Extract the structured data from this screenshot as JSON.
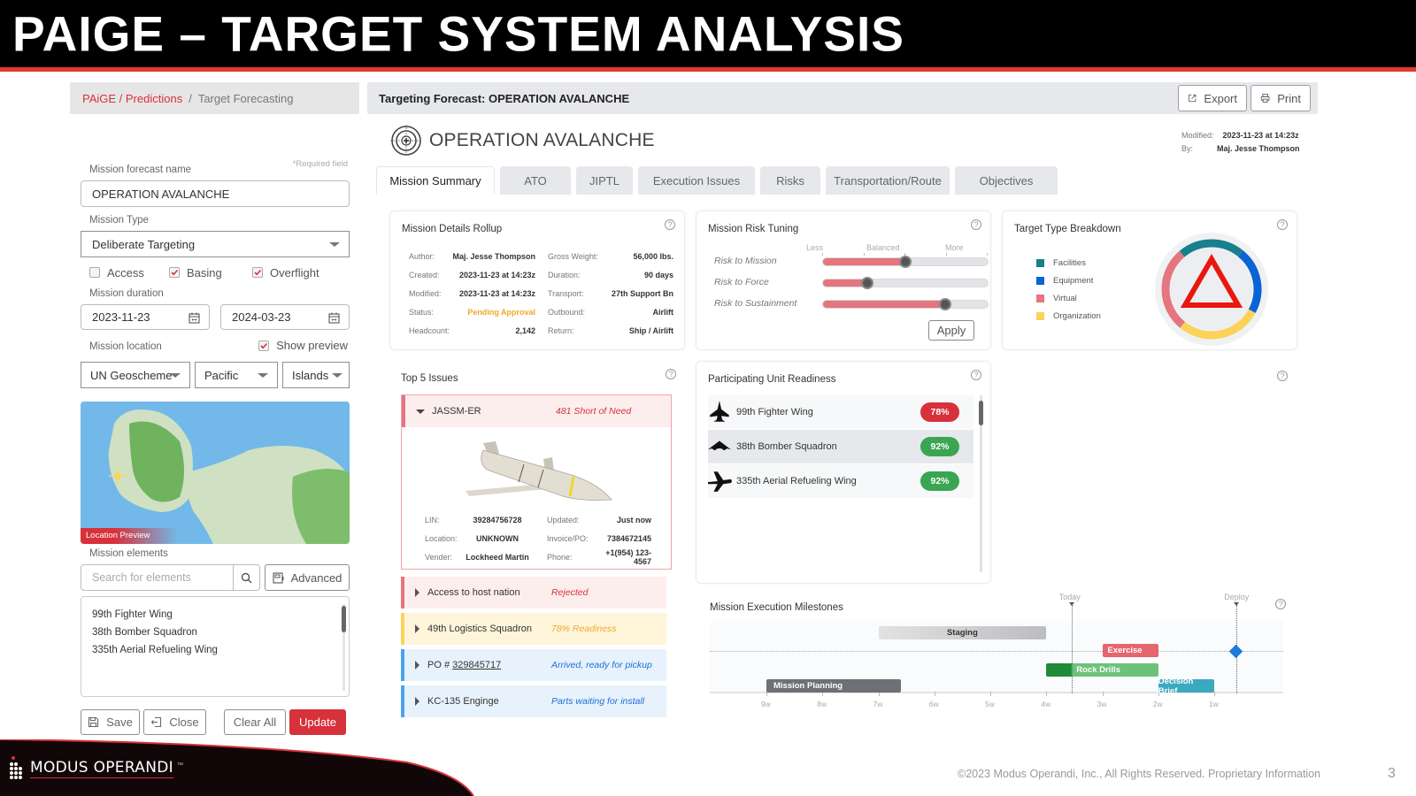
{
  "slide": {
    "title": "PAIGE – TARGET SYSTEM ANALYSIS",
    "footer": "©2023  Modus Operandi, Inc., All Rights Reserved.  Proprietary Information",
    "page_number": "3",
    "logo_text": "MODUS OPERANDI",
    "logo_tm": "™"
  },
  "breadcrumb": {
    "link": "PAiGE / Predictions",
    "separator": "/",
    "current": "Target Forecasting"
  },
  "header": {
    "title": "Targeting Forecast: OPERATION AVALANCHE",
    "export_label": "Export",
    "print_label": "Print"
  },
  "form": {
    "required_note": "*Required field",
    "name_label": "Mission forecast name",
    "name_value": "OPERATION AVALANCHE",
    "type_label": "Mission Type",
    "type_value": "Deliberate Targeting",
    "checkboxes": [
      {
        "label": "Access",
        "checked": false
      },
      {
        "label": "Basing",
        "checked": true
      },
      {
        "label": "Overflight",
        "checked": true
      }
    ],
    "duration_label": "Mission duration",
    "start_date": "2023-11-23",
    "end_date": "2024-03-23",
    "location_label": "Mission location",
    "show_preview_label": "Show preview",
    "show_preview_checked": true,
    "location_selects": [
      "UN Geoscheme",
      "Pacific",
      "Islands"
    ],
    "map_label": "Location Preview",
    "elements_label": "Mission elements",
    "search_placeholder": "Search for elements",
    "advanced_label": "Advanced",
    "elements": [
      "99th Fighter Wing",
      "38th Bomber Squadron",
      "335th Aerial Refueling Wing"
    ],
    "buttons": {
      "save": "Save",
      "close": "Close",
      "clear_all": "Clear All",
      "update": "Update"
    }
  },
  "operation": {
    "title": "OPERATION AVALANCHE",
    "modified_label": "Modified:",
    "modified_value": "2023-11-23 at 14:23z",
    "by_label": "By:",
    "by_value": "Maj. Jesse Thompson"
  },
  "tabs": [
    {
      "label": "Mission Summary",
      "active": true
    },
    {
      "label": "ATO",
      "active": false
    },
    {
      "label": "JIPTL",
      "active": false
    },
    {
      "label": "Execution Issues",
      "active": false
    },
    {
      "label": "Risks",
      "active": false
    },
    {
      "label": "Transportation/Route",
      "active": false
    },
    {
      "label": "Objectives",
      "active": false
    }
  ],
  "rollup": {
    "title": "Mission Details Rollup",
    "rows": [
      {
        "k1": "Author:",
        "v1": "Maj. Jesse Thompson",
        "k2": "Gross Weight:",
        "v2": "56,000 lbs."
      },
      {
        "k1": "Created:",
        "v1": "2023-11-23 at 14:23z",
        "k2": "Duration:",
        "v2": "90 days"
      },
      {
        "k1": "Modified:",
        "v1": "2023-11-23 at 14:23z",
        "k2": "Transport:",
        "v2": "27th Support Bn"
      },
      {
        "k1": "Status:",
        "v1": "Pending Approval",
        "k2": "Outbound:",
        "v2": "Airlift"
      },
      {
        "k1": "Headcount:",
        "v1": "2,142",
        "k2": "Return:",
        "v2": "Ship / Airlift"
      }
    ]
  },
  "risk": {
    "title": "Mission Risk Tuning",
    "scale": [
      "Less",
      "Balanced",
      "More"
    ],
    "sliders": [
      {
        "label": "Risk to Mission",
        "value": 0.5
      },
      {
        "label": "Risk to Force",
        "value": 0.27
      },
      {
        "label": "Risk to Sustainment",
        "value": 0.74
      }
    ],
    "apply_label": "Apply"
  },
  "breakdown": {
    "title": "Target Type Breakdown",
    "legend": [
      {
        "label": "Facilities",
        "color": "#17808c",
        "share": 0.22
      },
      {
        "label": "Equipment",
        "color": "#0a64d6",
        "share": 0.22
      },
      {
        "label": "Virtual",
        "color": "#e5757e",
        "share": 0.28
      },
      {
        "label": "Organization",
        "color": "#fcd25a",
        "share": 0.28
      }
    ]
  },
  "issues": {
    "title": "Top 5 Issues",
    "expanded": {
      "name": "JASSM-ER",
      "status": "481 Short of Need",
      "details": [
        {
          "k1": "LIN:",
          "v1": "39284756728",
          "k2": "Updated:",
          "v2": "Just now"
        },
        {
          "k1": "Location:",
          "v1": "UNKNOWN",
          "k2": "Invoice/PO:",
          "v2": "7384672145"
        },
        {
          "k1": "Vender:",
          "v1": "Lockheed Martin",
          "k2": "Phone:",
          "v2": "+1(954) 123-4567"
        }
      ]
    },
    "items": [
      {
        "name": "Access to host nation",
        "status": "Rejected",
        "level": "red"
      },
      {
        "name": "49th Logistics Squadron",
        "status": "78% Readiness",
        "level": "yellow"
      },
      {
        "name_prefix": "PO # ",
        "name_link": "329845717",
        "status": "Arrived, ready for pickup",
        "level": "blue"
      },
      {
        "name": "KC-135 Enginge",
        "status": "Parts waiting for install",
        "level": "blue"
      }
    ]
  },
  "readiness": {
    "title": "Participating Unit Readiness",
    "units": [
      {
        "name": "99th Fighter Wing",
        "value": "78%",
        "status": "red"
      },
      {
        "name": "38th Bomber Squadron",
        "value": "92%",
        "status": "green"
      },
      {
        "name": "335th Aerial Refueling Wing",
        "value": "92%",
        "status": "green"
      }
    ]
  },
  "milestones": {
    "title": "Mission Execution Milestones",
    "markers": [
      {
        "label": "Today",
        "week": 3.55
      },
      {
        "label": "Deploy",
        "week": 0.6
      }
    ],
    "ticks": [
      "9w",
      "8w",
      "7w",
      "6w",
      "5w",
      "4w",
      "3w",
      "2w",
      "1w"
    ],
    "bars": [
      {
        "label": "Staging",
        "start": 7.0,
        "end": 4.0,
        "row": 0,
        "color": "gray"
      },
      {
        "label": "Exercise",
        "start": 3.0,
        "end": 2.0,
        "row": 1,
        "color": "red"
      },
      {
        "label": "Rock Drills",
        "start": 4.0,
        "end": 2.0,
        "row": 2,
        "color": "green"
      },
      {
        "label": "Mission Planning",
        "start": 9.0,
        "end": 6.6,
        "row": 3,
        "color": "dark"
      },
      {
        "label": "Decision Brief",
        "start": 2.0,
        "end": 1.0,
        "row": 3,
        "color": "teal"
      }
    ]
  }
}
